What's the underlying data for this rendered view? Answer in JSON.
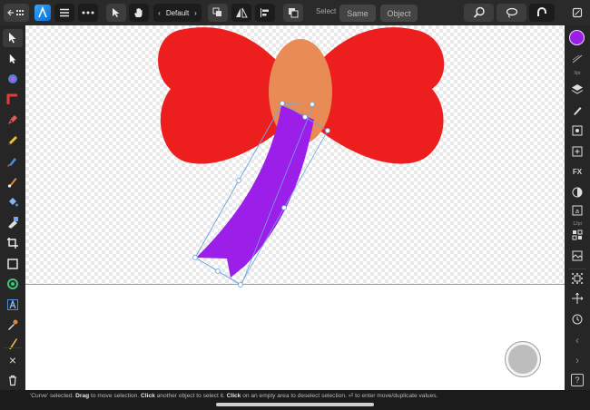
{
  "toolbar": {
    "back_icon": "grid-back-icon",
    "app_icon": "affinity-designer-persona",
    "menu_icon": "hamburger-icon",
    "more_icon": "ellipsis-icon",
    "move_tool_icon": "arrow-pointer-icon",
    "hand_tool_icon": "hand-icon",
    "persona_prev": "‹",
    "persona_label": "Default",
    "persona_next": "›",
    "select_label": "Select",
    "same_button": "Same",
    "object_button": "Object",
    "zoom_icon": "magnifier-icon",
    "lasso_icon": "lasso-icon",
    "snapping_icon": "magnet-icon",
    "document_icon": "document-icon"
  },
  "left_tools": [
    {
      "name": "move-tool",
      "icon": "arrow"
    },
    {
      "name": "node-tool",
      "icon": "node-arrow"
    },
    {
      "name": "fill-tool",
      "icon": "fill"
    },
    {
      "name": "corner-tool",
      "icon": "corner"
    },
    {
      "name": "pen-tool",
      "icon": "pen"
    },
    {
      "name": "pencil-tool",
      "icon": "pencil"
    },
    {
      "name": "vector-brush-tool",
      "icon": "brush"
    },
    {
      "name": "paint-brush-tool",
      "icon": "paint-brush"
    },
    {
      "name": "fill-bucket-tool",
      "icon": "bucket"
    },
    {
      "name": "transparency-tool",
      "icon": "transparency"
    },
    {
      "name": "crop-tool",
      "icon": "crop"
    },
    {
      "name": "rectangle-tool",
      "icon": "rectangle"
    },
    {
      "name": "ellipse-tool",
      "icon": "ellipse"
    },
    {
      "name": "text-tool",
      "icon": "text"
    },
    {
      "name": "color-picker-tool",
      "icon": "picker"
    },
    {
      "name": "knife-tool",
      "icon": "knife"
    }
  ],
  "left_bottom": {
    "close_icon": "×",
    "delete_icon": "trash-icon"
  },
  "right_studio": {
    "color_swatch": "#9b1fe8",
    "stroke_label": "0pt",
    "layer_effects_label": "12pt",
    "icons": [
      "layers-icon",
      "brush-icon",
      "transform-icon",
      "constraints-icon",
      "fx-icon",
      "appearance-icon",
      "text-styles-icon",
      "symbols-icon",
      "assets-icon",
      "navigator-icon",
      "snap-grid-icon",
      "history-icon",
      "chevron-left-icon",
      "chevron-right-icon",
      "help-icon"
    ],
    "help_label": "?"
  },
  "status": {
    "text_parts": [
      "'Curve' selected. ",
      "Drag",
      " to move selection. ",
      "Click",
      " another object to select it. ",
      "Click",
      " on an empty area to deselect selection. ⏎ to enter move/duplicate values."
    ]
  },
  "colors": {
    "bow_red": "#ec1e1e",
    "knot_orange": "#e98b55",
    "ribbon_purple": "#9b1fe8",
    "selection_blue": "#6fa9e0"
  }
}
